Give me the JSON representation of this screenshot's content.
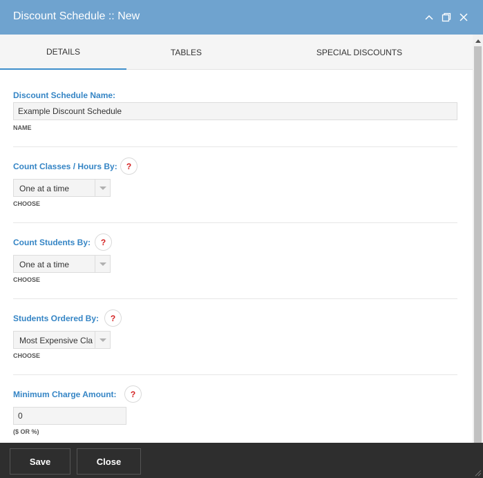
{
  "window": {
    "title": "Discount Schedule :: New",
    "controls": [
      "chevron-up-icon",
      "maximize-icon",
      "close-icon"
    ]
  },
  "tabs": [
    {
      "label": "DETAILS",
      "active": true
    },
    {
      "label": "TABLES",
      "active": false
    },
    {
      "label": "SPECIAL DISCOUNTS",
      "active": false
    }
  ],
  "form": {
    "name": {
      "label": "Discount Schedule Name:",
      "value": "Example Discount Schedule",
      "hint": "NAME"
    },
    "count_classes": {
      "label": "Count Classes / Hours By:",
      "help": "?",
      "value": "One at a time",
      "hint": "CHOOSE"
    },
    "count_students": {
      "label": "Count Students By:",
      "help": "?",
      "value": "One at a time",
      "hint": "CHOOSE"
    },
    "students_ordered": {
      "label": "Students Ordered By:",
      "help": "?",
      "value": "Most Expensive Class",
      "hint": "CHOOSE"
    },
    "min_charge": {
      "label": "Minimum Charge Amount:",
      "help": "?",
      "value": "0",
      "hint": "($ OR %)"
    }
  },
  "footer": {
    "save_label": "Save",
    "close_label": "Close"
  },
  "colors": {
    "titlebar": "#6fa3cf",
    "label": "#3585c5",
    "help": "#d42020",
    "footer": "#2e2e2e",
    "active_tab": "#3d8ecb"
  }
}
